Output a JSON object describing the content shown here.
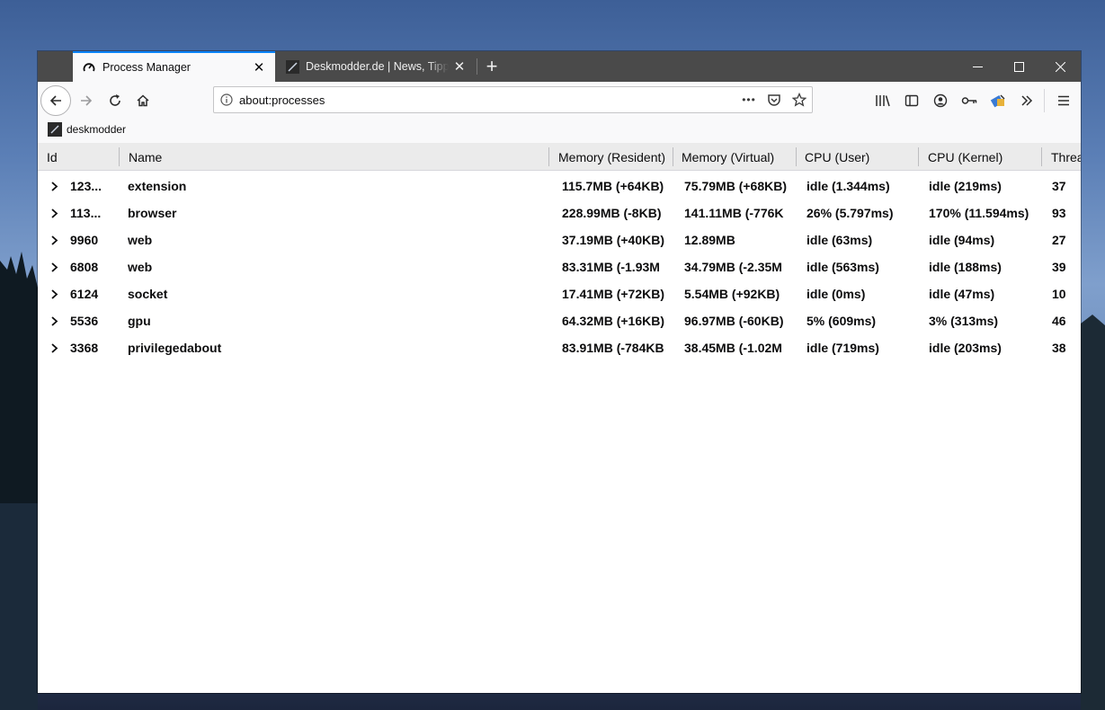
{
  "tabs": [
    {
      "title": "Process Manager",
      "active": true,
      "icon": "gauge-icon"
    },
    {
      "title": "Deskmodder.de | News, Tipps und",
      "active": false,
      "icon": "deskmodder-favicon"
    }
  ],
  "window_controls": {
    "minimize": "—",
    "maximize": "☐",
    "close": "✕"
  },
  "navbar": {
    "url": "about:processes",
    "page_actions": "•••"
  },
  "bookmarks": [
    {
      "label": "deskmodder"
    }
  ],
  "table": {
    "headers": [
      "Id",
      "Name",
      "Memory (Resident)",
      "Memory (Virtual)",
      "CPU (User)",
      "CPU (Kernel)",
      "Threads"
    ],
    "rows": [
      {
        "id": "123...",
        "name": "extension",
        "mem_res": "115.7MB (+64KB)",
        "mem_virt": "75.79MB (+68KB)",
        "cpu_user": "idle (1.344ms)",
        "cpu_kernel": "idle (219ms)",
        "threads": "37"
      },
      {
        "id": "113...",
        "name": "browser",
        "mem_res": "228.99MB (-8KB)",
        "mem_virt": "141.11MB (-776K",
        "cpu_user": "26% (5.797ms)",
        "cpu_kernel": "170% (11.594ms)",
        "threads": "93"
      },
      {
        "id": "9960",
        "name": "web",
        "mem_res": "37.19MB (+40KB)",
        "mem_virt": "12.89MB",
        "cpu_user": "idle (63ms)",
        "cpu_kernel": "idle (94ms)",
        "threads": "27"
      },
      {
        "id": "6808",
        "name": "web",
        "mem_res": "83.31MB (-1.93M",
        "mem_virt": "34.79MB (-2.35M",
        "cpu_user": "idle (563ms)",
        "cpu_kernel": "idle (188ms)",
        "threads": "39"
      },
      {
        "id": "6124",
        "name": "socket",
        "mem_res": "17.41MB (+72KB)",
        "mem_virt": "5.54MB (+92KB)",
        "cpu_user": "idle (0ms)",
        "cpu_kernel": "idle (47ms)",
        "threads": "10"
      },
      {
        "id": "5536",
        "name": "gpu",
        "mem_res": "64.32MB (+16KB)",
        "mem_virt": "96.97MB (-60KB)",
        "cpu_user": "5% (609ms)",
        "cpu_kernel": "3% (313ms)",
        "threads": "46"
      },
      {
        "id": "3368",
        "name": "privilegedabout",
        "mem_res": "83.91MB (-784KB",
        "mem_virt": "38.45MB (-1.02M",
        "cpu_user": "idle (719ms)",
        "cpu_kernel": "idle (203ms)",
        "threads": "38"
      }
    ]
  },
  "colors": {
    "tab_strip": "#4a4a4a",
    "accent": "#0a84ff",
    "toolbar": "#f9f9fa"
  }
}
